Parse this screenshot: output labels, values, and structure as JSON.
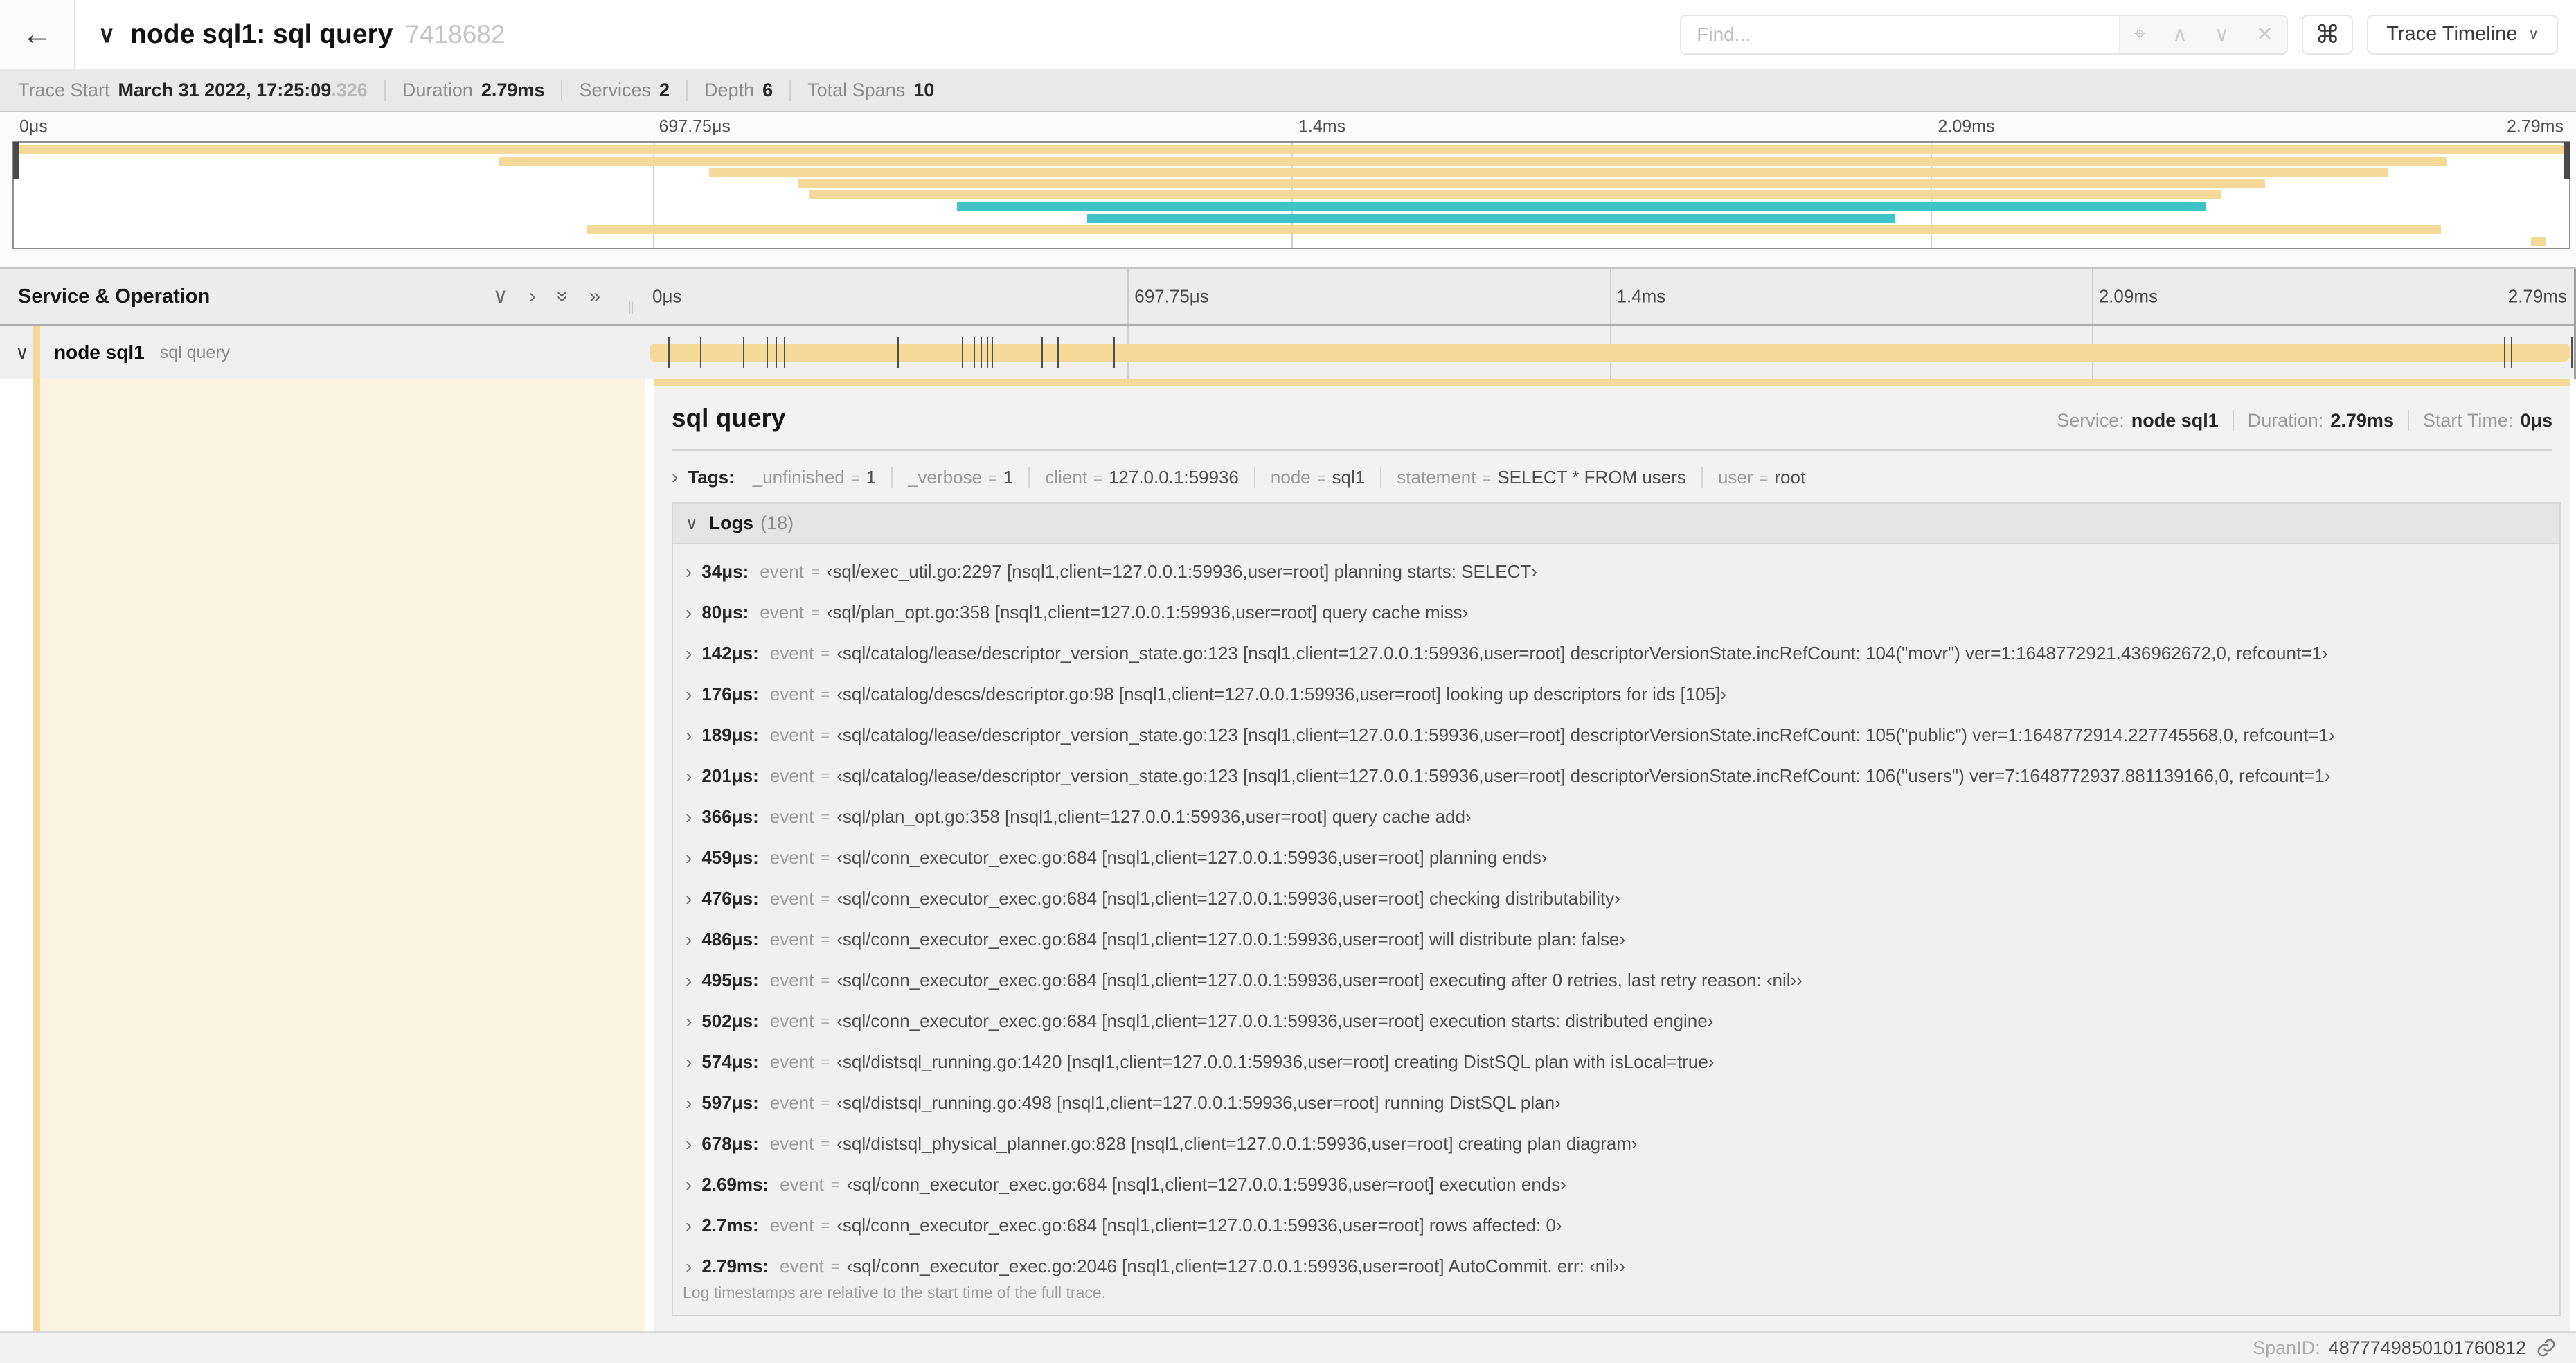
{
  "header": {
    "back_icon": "←",
    "collapse_icon": "∨",
    "title": "node sql1: sql query",
    "trace_id": "7418682",
    "find": {
      "placeholder": "Find...",
      "locate_icon": "⌖",
      "prev_icon": "∧",
      "next_icon": "∨",
      "clear_icon": "✕"
    },
    "shortcuts_button": "⌘",
    "view_select": {
      "label": "Trace Timeline",
      "caret": "∨"
    }
  },
  "trace_meta": {
    "items": [
      {
        "label": "Trace Start",
        "value": "March 31 2022, 17:25:09",
        "suffix": ".326"
      },
      {
        "label": "Duration",
        "value": "2.79ms",
        "suffix": ""
      },
      {
        "label": "Services",
        "value": "2",
        "suffix": ""
      },
      {
        "label": "Depth",
        "value": "6",
        "suffix": ""
      },
      {
        "label": "Total Spans",
        "value": "10",
        "suffix": ""
      }
    ]
  },
  "ruler": {
    "ticks": [
      {
        "label": "0μs",
        "pct": 0,
        "align": "left"
      },
      {
        "label": "697.75μs",
        "pct": 25,
        "align": "left"
      },
      {
        "label": "1.4ms",
        "pct": 50,
        "align": "left"
      },
      {
        "label": "2.09ms",
        "pct": 75,
        "align": "left"
      },
      {
        "label": "2.79ms",
        "pct": 100,
        "align": "right"
      }
    ]
  },
  "colors": {
    "span_tan": "#F5D999",
    "span_teal": "#3EC3C7",
    "detail_cream": "#FCF4E1"
  },
  "minimap": {
    "spans": [
      {
        "start": 0,
        "end": 100,
        "color": "#F5D999"
      },
      {
        "start": 19.0,
        "end": 95.2,
        "color": "#F5D999"
      },
      {
        "start": 27.2,
        "end": 92.9,
        "color": "#F5D999"
      },
      {
        "start": 30.7,
        "end": 88.1,
        "color": "#F5D999"
      },
      {
        "start": 31.1,
        "end": 86.4,
        "color": "#F5D999"
      },
      {
        "start": 36.9,
        "end": 85.8,
        "color": "#3EC3C7"
      },
      {
        "start": 42.0,
        "end": 73.6,
        "color": "#3EC3C7"
      },
      {
        "start": 22.4,
        "end": 95.0,
        "color": "#F5D999"
      },
      {
        "start": 98.5,
        "end": 99.1,
        "color": "#F5D999"
      }
    ]
  },
  "timeline_header": {
    "title": "Service & Operation",
    "collapse_one_icon": "∨",
    "expand_one_icon": "›",
    "collapse_all_icon": "»",
    "expand_all_icon": "»",
    "grip": "‖"
  },
  "span_row": {
    "chevron_icon": "∨",
    "service": "node sql1",
    "operation": "sql query",
    "log_tick_pcts": [
      1.22,
      2.87,
      5.09,
      6.31,
      6.77,
      7.2,
      13.12,
      16.45,
      17.06,
      17.42,
      17.74,
      17.99,
      20.57,
      21.4,
      24.3,
      96.42,
      96.77,
      99.9
    ]
  },
  "detail": {
    "title": "sql query",
    "meta": [
      {
        "label": "Service:",
        "value": "node sql1"
      },
      {
        "label": "Duration:",
        "value": "2.79ms"
      },
      {
        "label": "Start Time:",
        "value": "0μs"
      }
    ],
    "tags": {
      "chevron": "›",
      "label": "Tags:",
      "eq_symbol": "=",
      "items": [
        {
          "key": "_unfinished",
          "value": "1"
        },
        {
          "key": "_verbose",
          "value": "1"
        },
        {
          "key": "client",
          "value": "127.0.0.1:59936"
        },
        {
          "key": "node",
          "value": "sql1"
        },
        {
          "key": "statement",
          "value": "SELECT * FROM users"
        },
        {
          "key": "user",
          "value": "root"
        }
      ]
    },
    "logs": {
      "chevron": "∨",
      "label": "Logs",
      "count": "(18)",
      "row_chevron": "›",
      "eq_symbol": "=",
      "rows": [
        {
          "time": "34μs:",
          "field": "event",
          "value": "‹sql/exec_util.go:2297 [nsql1,client=127.0.0.1:59936,user=root] planning starts: SELECT›"
        },
        {
          "time": "80μs:",
          "field": "event",
          "value": "‹sql/plan_opt.go:358 [nsql1,client=127.0.0.1:59936,user=root] query cache miss›"
        },
        {
          "time": "142μs:",
          "field": "event",
          "value": "‹sql/catalog/lease/descriptor_version_state.go:123 [nsql1,client=127.0.0.1:59936,user=root] descriptorVersionState.incRefCount: 104(\"movr\") ver=1:1648772921.436962672,0, refcount=1›"
        },
        {
          "time": "176μs:",
          "field": "event",
          "value": "‹sql/catalog/descs/descriptor.go:98 [nsql1,client=127.0.0.1:59936,user=root] looking up descriptors for ids [105]›"
        },
        {
          "time": "189μs:",
          "field": "event",
          "value": "‹sql/catalog/lease/descriptor_version_state.go:123 [nsql1,client=127.0.0.1:59936,user=root] descriptorVersionState.incRefCount: 105(\"public\") ver=1:1648772914.227745568,0, refcount=1›"
        },
        {
          "time": "201μs:",
          "field": "event",
          "value": "‹sql/catalog/lease/descriptor_version_state.go:123 [nsql1,client=127.0.0.1:59936,user=root] descriptorVersionState.incRefCount: 106(\"users\") ver=7:1648772937.881139166,0, refcount=1›"
        },
        {
          "time": "366μs:",
          "field": "event",
          "value": "‹sql/plan_opt.go:358 [nsql1,client=127.0.0.1:59936,user=root] query cache add›"
        },
        {
          "time": "459μs:",
          "field": "event",
          "value": "‹sql/conn_executor_exec.go:684 [nsql1,client=127.0.0.1:59936,user=root] planning ends›"
        },
        {
          "time": "476μs:",
          "field": "event",
          "value": "‹sql/conn_executor_exec.go:684 [nsql1,client=127.0.0.1:59936,user=root] checking distributability›"
        },
        {
          "time": "486μs:",
          "field": "event",
          "value": "‹sql/conn_executor_exec.go:684 [nsql1,client=127.0.0.1:59936,user=root] will distribute plan: false›"
        },
        {
          "time": "495μs:",
          "field": "event",
          "value": "‹sql/conn_executor_exec.go:684 [nsql1,client=127.0.0.1:59936,user=root] executing after 0 retries, last retry reason: ‹nil››"
        },
        {
          "time": "502μs:",
          "field": "event",
          "value": "‹sql/conn_executor_exec.go:684 [nsql1,client=127.0.0.1:59936,user=root] execution starts: distributed engine›"
        },
        {
          "time": "574μs:",
          "field": "event",
          "value": "‹sql/distsql_running.go:1420 [nsql1,client=127.0.0.1:59936,user=root] creating DistSQL plan with isLocal=true›"
        },
        {
          "time": "597μs:",
          "field": "event",
          "value": "‹sql/distsql_running.go:498 [nsql1,client=127.0.0.1:59936,user=root] running DistSQL plan›"
        },
        {
          "time": "678μs:",
          "field": "event",
          "value": "‹sql/distsql_physical_planner.go:828 [nsql1,client=127.0.0.1:59936,user=root] creating plan diagram›"
        },
        {
          "time": "2.69ms:",
          "field": "event",
          "value": "‹sql/conn_executor_exec.go:684 [nsql1,client=127.0.0.1:59936,user=root] execution ends›"
        },
        {
          "time": "2.7ms:",
          "field": "event",
          "value": "‹sql/conn_executor_exec.go:684 [nsql1,client=127.0.0.1:59936,user=root] rows affected: 0›"
        },
        {
          "time": "2.79ms:",
          "field": "event",
          "value": "‹sql/conn_executor_exec.go:2046 [nsql1,client=127.0.0.1:59936,user=root] AutoCommit. err: ‹nil››"
        }
      ],
      "note": "Log timestamps are relative to the start time of the full trace."
    },
    "footer": {
      "label": "SpanID:",
      "value": "4877749850101760812"
    }
  }
}
